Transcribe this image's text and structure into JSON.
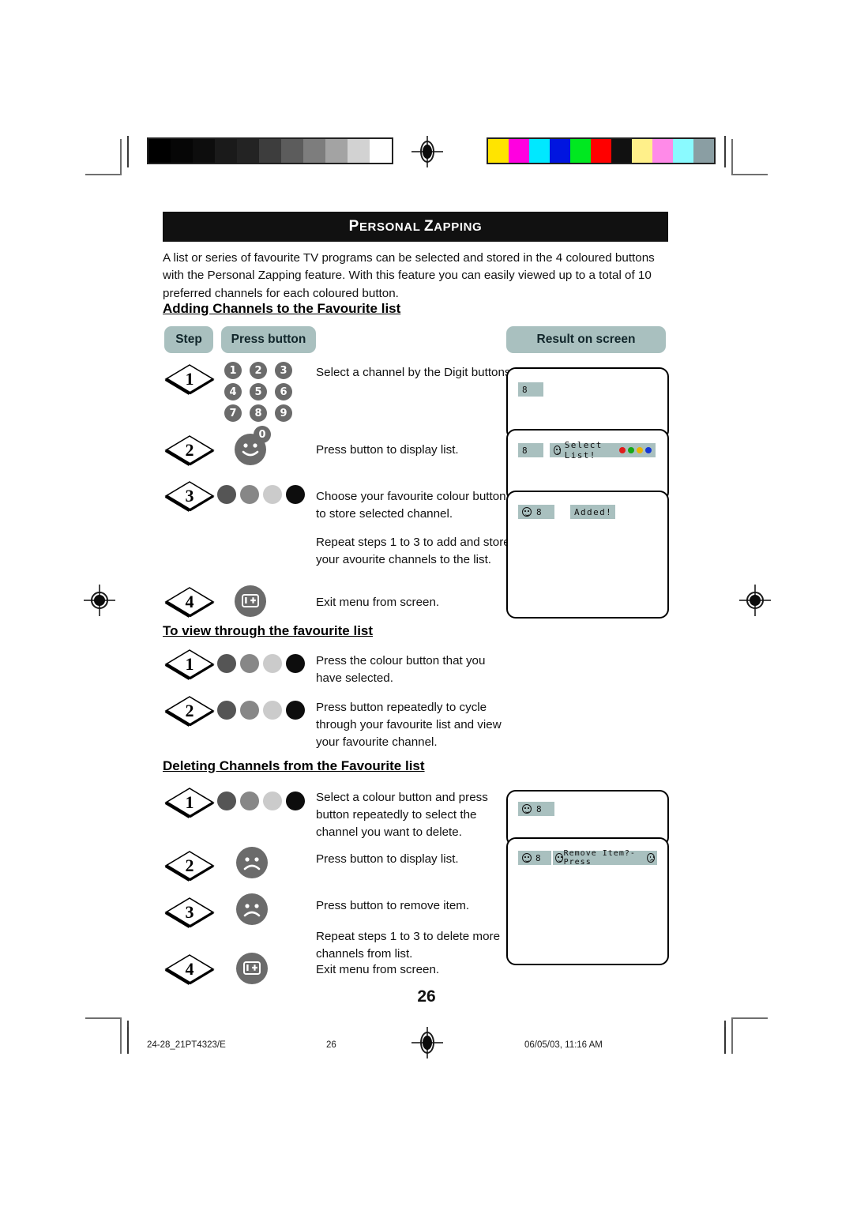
{
  "document": {
    "title": "Personal Zapping",
    "title_first_caps": "P",
    "title_rest_1": "ERSONAL ",
    "title_first_caps2": "Z",
    "title_rest_2": "APPING",
    "page_number": "26",
    "intro": "A list or series of favourite TV programs can be selected and stored in the 4 coloured buttons with the Personal Zapping feature. With this feature you can easily viewed up to a total of 10 preferred channels for each coloured button."
  },
  "table_headers": {
    "step": "Step",
    "press_button": "Press button",
    "result_on_screen": "Result on screen"
  },
  "sections": [
    {
      "heading": "Adding Channels to the Favourite list",
      "steps": [
        {
          "number": "1",
          "icon": "digit-keypad",
          "text": "Select a channel by the Digit buttons"
        },
        {
          "number": "2",
          "icon": "smiley-happy-button",
          "text": "Press button to display list."
        },
        {
          "number": "3",
          "icon": "colour-buttons",
          "text": "Choose your favourite colour button to store selected channel."
        },
        {
          "number": "",
          "icon": "none",
          "text": "Repeat steps 1 to 3 to add and store your avourite channels to the list."
        },
        {
          "number": "4",
          "icon": "info-exit-button",
          "text": "Exit menu from screen."
        }
      ]
    },
    {
      "heading": "To view through the favourite list",
      "steps": [
        {
          "number": "1",
          "icon": "colour-buttons",
          "text": "Press the colour button that you have selected."
        },
        {
          "number": "2",
          "icon": "colour-buttons",
          "text": "Press button repeatedly to cycle through your favourite list and view your favourite channel."
        }
      ]
    },
    {
      "heading": "Deleting Channels from the Favourite list",
      "steps": [
        {
          "number": "1",
          "icon": "colour-buttons",
          "text": "Select a colour button and press button repeatedly to select the channel you want to delete."
        },
        {
          "number": "2",
          "icon": "smiley-sad-button",
          "text": "Press button to display list."
        },
        {
          "number": "3",
          "icon": "smiley-sad-button",
          "text": "Press button to remove item."
        },
        {
          "number": "",
          "icon": "none",
          "text": "Repeat steps 1 to 3 to delete more channels from list."
        },
        {
          "number": "4",
          "icon": "info-exit-button",
          "text": "Exit menu from screen."
        }
      ]
    }
  ],
  "keypad": {
    "rows": [
      [
        "1",
        "2",
        "3"
      ],
      [
        "4",
        "5",
        "6"
      ],
      [
        "7",
        "8",
        "9"
      ],
      [
        "0"
      ]
    ]
  },
  "colour_buttons": [
    "#555555",
    "#878787",
    "#cbcbcb",
    "#0d0d0d"
  ],
  "osd_screens": {
    "add": [
      {
        "name": "channel-only",
        "channel": "8",
        "message": "",
        "dots": []
      },
      {
        "name": "select-list",
        "channel": "8",
        "message": "Select List!",
        "dots": [
          "#e01b1b",
          "#16a816",
          "#e8b400",
          "#1436d6"
        ]
      },
      {
        "name": "added",
        "channel": "8",
        "message": "Added!",
        "dots": []
      }
    ],
    "delete": [
      {
        "name": "channel-only",
        "channel": "8",
        "message": "",
        "dots": []
      },
      {
        "name": "remove-item",
        "channel": "8",
        "message": "Remove Item?- Press",
        "dots": []
      }
    ]
  },
  "osd_colors": {
    "background": "#a9c0bf",
    "text": "#111111"
  },
  "footer": {
    "file_ref": "24-28_21PT4323/E",
    "page": "26",
    "timestamp": "06/05/03, 11:16 AM"
  },
  "print_bars": {
    "greyscale": [
      "#000000",
      "#060606",
      "#0d0d0d",
      "#1a1a1a",
      "#232323",
      "#3d3d3d",
      "#5c5c5c",
      "#7d7d7d",
      "#a3a3a3",
      "#d2d2d2",
      "#ffffff"
    ],
    "colour": [
      "#ffe400",
      "#ff00e0",
      "#00e8ff",
      "#0015e0",
      "#00e820",
      "#ff0000",
      "#111111",
      "#fff08a",
      "#ff8ae8",
      "#8afaff",
      "#8a9ea3"
    ]
  }
}
